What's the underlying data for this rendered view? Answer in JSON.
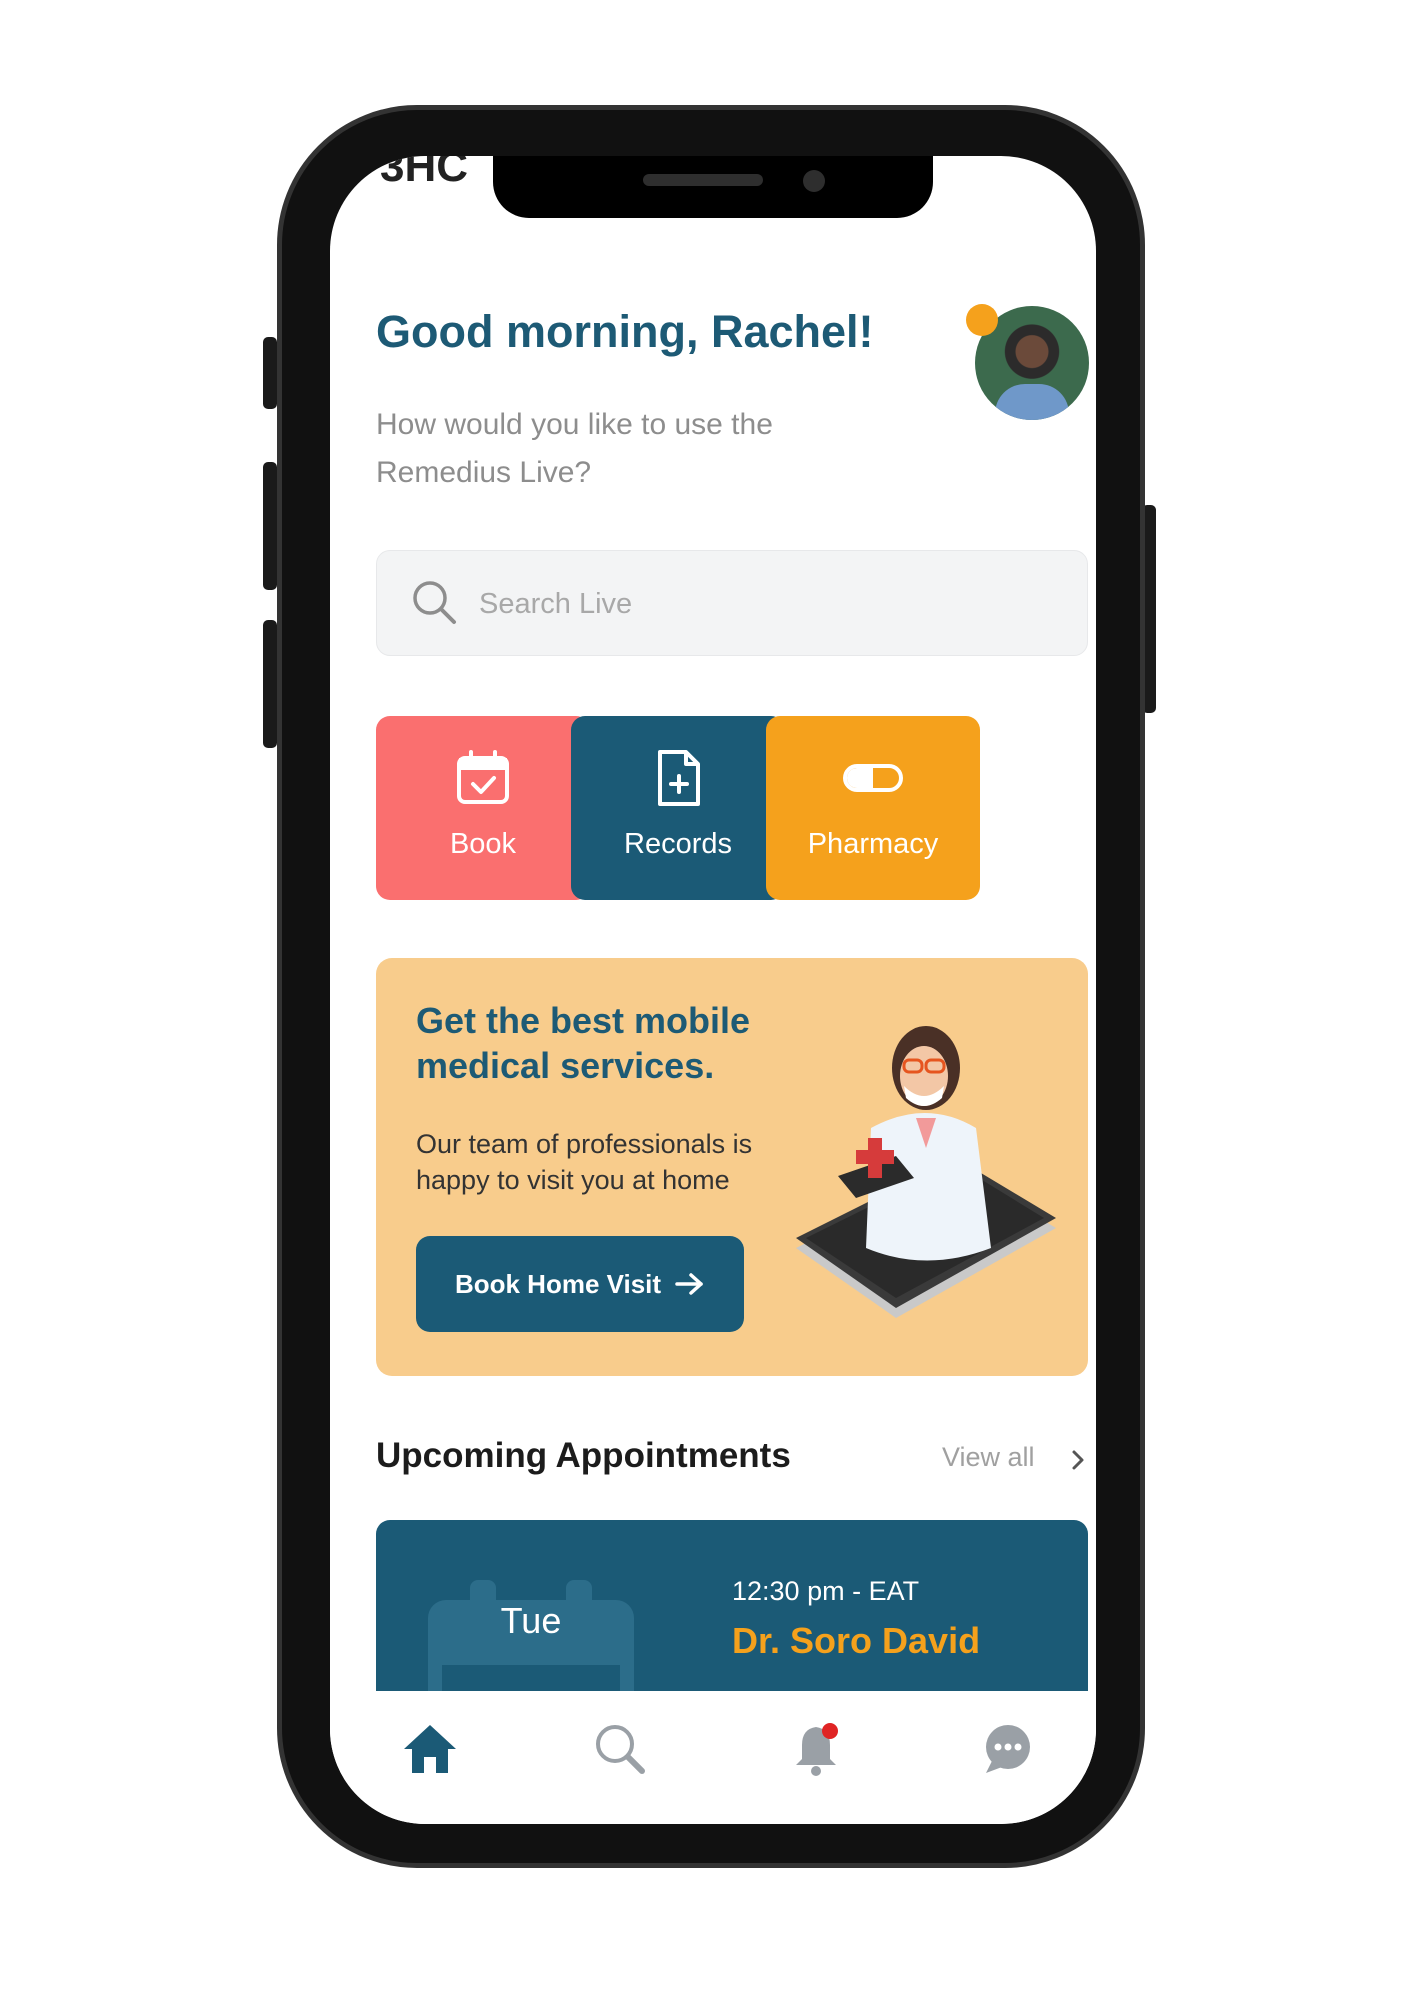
{
  "status_bar": {
    "partial_text": "3HC"
  },
  "header": {
    "greeting": "Good morning, Rachel!",
    "subtitle": "How would you like to use the Remedius Live?"
  },
  "search": {
    "placeholder": "Search Live"
  },
  "actions": [
    {
      "label": "Book",
      "icon": "calendar-check-icon",
      "color": "#fa6f6f"
    },
    {
      "label": "Records",
      "icon": "medical-file-icon",
      "color": "#1b5a76"
    },
    {
      "label": "Pharmacy",
      "icon": "pill-icon",
      "color": "#f5a11c"
    }
  ],
  "promo": {
    "title": "Get the best mobile medical services.",
    "text": "Our team of professionals is happy to visit you at home",
    "button_label": "Book Home Visit",
    "background": "#f8cc8c"
  },
  "appointments": {
    "title": "Upcoming Appointments",
    "view_all": "View all",
    "items": [
      {
        "day": "Tue",
        "time": "12:30 pm - EAT",
        "doctor": "Dr. Soro David"
      }
    ]
  },
  "bottom_nav": [
    {
      "icon": "home-icon",
      "active": true
    },
    {
      "icon": "search-icon",
      "active": false
    },
    {
      "icon": "bell-icon",
      "active": false,
      "badge": true
    },
    {
      "icon": "chat-icon",
      "active": false
    }
  ],
  "colors": {
    "primary": "#1b5a76",
    "accent": "#f5a11c",
    "coral": "#fa6f6f"
  }
}
